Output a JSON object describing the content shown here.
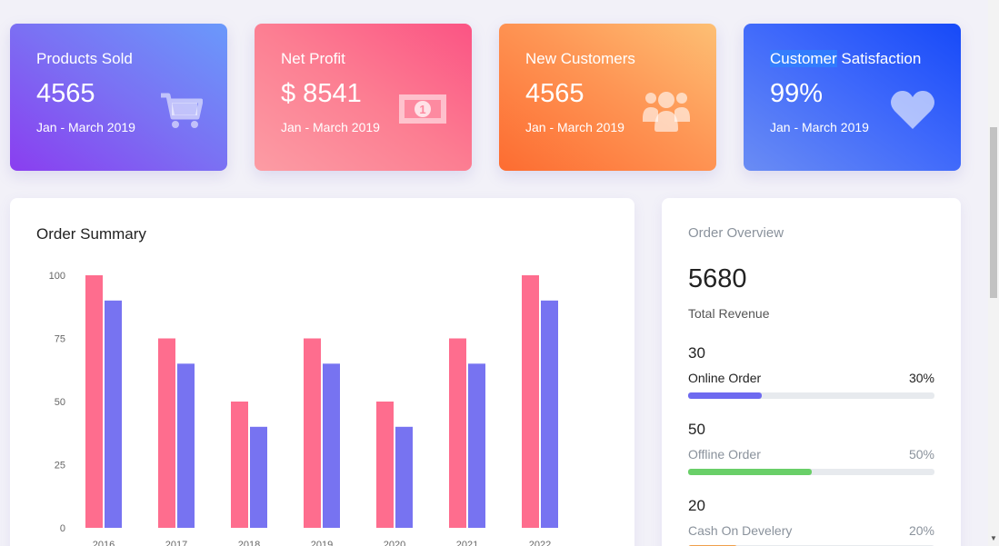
{
  "cards": [
    {
      "title": "Products Sold",
      "value": "4565",
      "period": "Jan - March 2019",
      "icon": "cart-icon"
    },
    {
      "title": "Net Profit",
      "value": "$ 8541",
      "period": "Jan - March 2019",
      "icon": "money-icon"
    },
    {
      "title": "New Customers",
      "value": "4565",
      "period": "Jan - March 2019",
      "icon": "users-icon"
    },
    {
      "title_a": "Customer",
      "title_b": " Satisfaction",
      "value": "99%",
      "period": "Jan - March 2019",
      "icon": "heart-icon"
    }
  ],
  "order_summary": {
    "title": "Order Summary"
  },
  "chart_data": {
    "type": "bar",
    "categories": [
      "2016",
      "2017",
      "2018",
      "2019",
      "2020",
      "2021",
      "2022"
    ],
    "series": [
      {
        "values": [
          100,
          75,
          50,
          75,
          50,
          75,
          100
        ],
        "color": "#fe6d8e"
      },
      {
        "values": [
          90,
          65,
          40,
          65,
          40,
          65,
          90
        ],
        "color": "#7773f1"
      }
    ],
    "yticks": [
      0,
      25,
      50,
      75,
      100
    ],
    "ylim": [
      0,
      100
    ],
    "grid": false
  },
  "order_overview": {
    "title": "Order Overview",
    "total": "5680",
    "total_label": "Total Revenue",
    "items": [
      {
        "count": "30",
        "label": "Online Order",
        "percent_text": "30%",
        "percent": 30,
        "color": "#6e6af0",
        "muted": false
      },
      {
        "count": "50",
        "label": "Offline Order",
        "percent_text": "50%",
        "percent": 50,
        "color": "#69cf68",
        "muted": true
      },
      {
        "count": "20",
        "label": "Cash On Develery",
        "percent_text": "20%",
        "percent": 20,
        "color": "#f0a04b",
        "muted": true
      }
    ]
  }
}
